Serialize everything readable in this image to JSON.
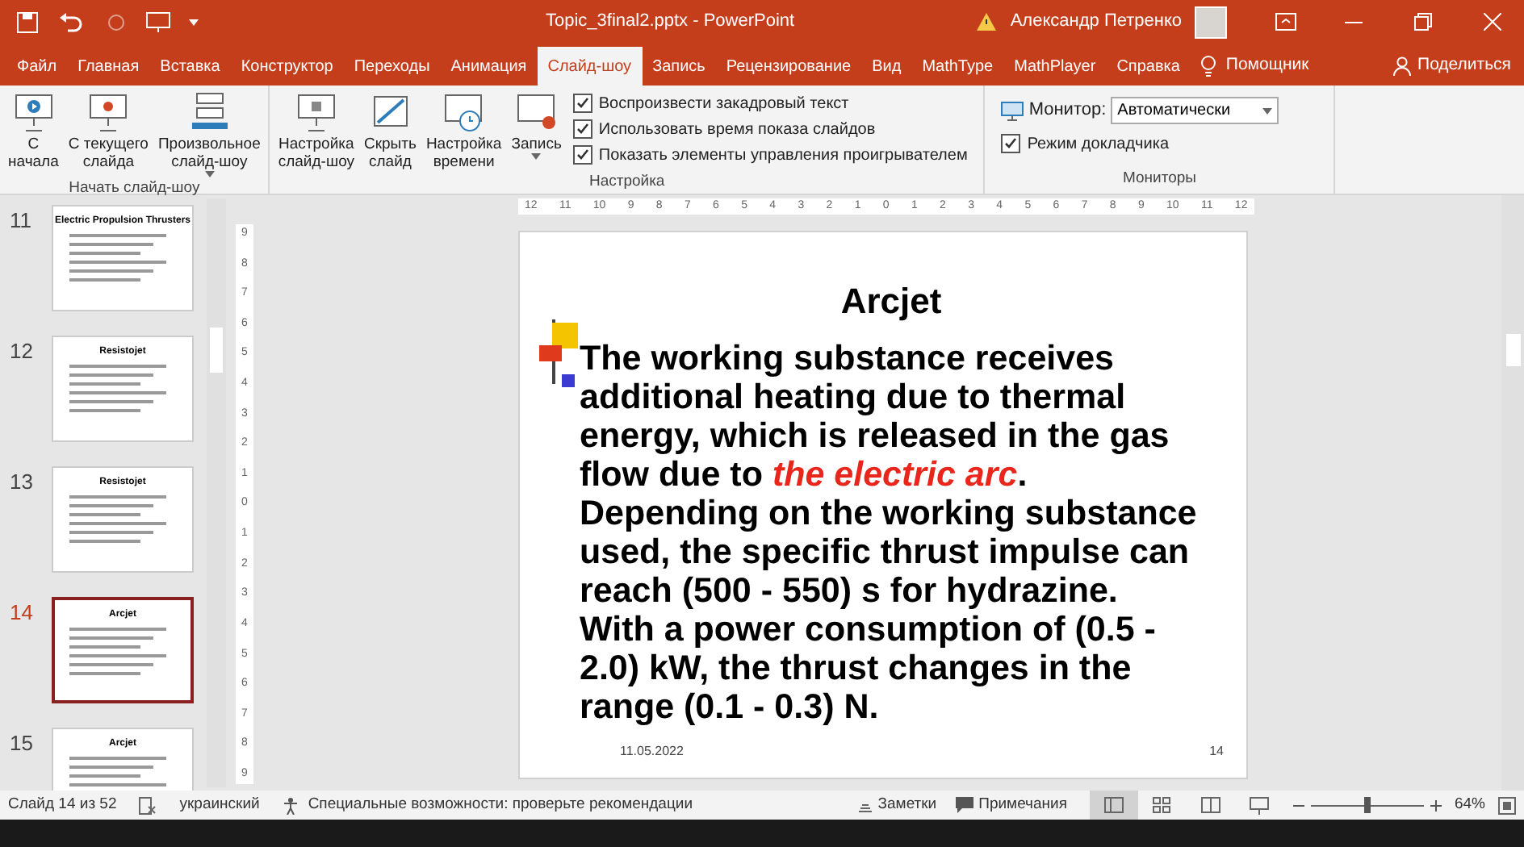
{
  "window": {
    "title": "Topic_3final2.pptx - PowerPoint",
    "user": "Александр Петренко"
  },
  "tabs": [
    {
      "label": "Файл",
      "selected": false
    },
    {
      "label": "Главная",
      "selected": false
    },
    {
      "label": "Вставка",
      "selected": false
    },
    {
      "label": "Конструктор",
      "selected": false
    },
    {
      "label": "Переходы",
      "selected": false
    },
    {
      "label": "Анимация",
      "selected": false
    },
    {
      "label": "Слайд-шоу",
      "selected": true
    },
    {
      "label": "Запись",
      "selected": false
    },
    {
      "label": "Рецензирование",
      "selected": false
    },
    {
      "label": "Вид",
      "selected": false
    },
    {
      "label": "MathType",
      "selected": false
    },
    {
      "label": "MathPlayer",
      "selected": false
    },
    {
      "label": "Справка",
      "selected": false
    }
  ],
  "assistant": "Помощник",
  "share": "Поделиться",
  "ribbon": {
    "groups": [
      {
        "title": "Начать слайд-шоу",
        "buttons": [
          {
            "label": "С\nначала",
            "caret": false
          },
          {
            "label": "С текущего\nслайда",
            "caret": false
          },
          {
            "label": "Произвольное\nслайд-шоу",
            "caret": true
          }
        ]
      },
      {
        "title": "Настройка",
        "buttons": [
          {
            "label": "Настройка\nслайд-шоу",
            "caret": false
          },
          {
            "label": "Скрыть\nслайд",
            "caret": false
          },
          {
            "label": "Настройка\nвремени",
            "caret": false
          },
          {
            "label": "Запись",
            "caret": true
          }
        ],
        "checkboxes": [
          {
            "label": "Воспроизвести закадровый текст",
            "checked": true
          },
          {
            "label": "Использовать время показа слайдов",
            "checked": true
          },
          {
            "label": "Показать элементы управления проигрывателем",
            "checked": true
          }
        ]
      },
      {
        "title": "Мониторы",
        "monitor_label": "Монитор:",
        "monitor_value": "Автоматически",
        "checkboxes": [
          {
            "label": "Режим докладчика",
            "checked": true
          }
        ]
      }
    ]
  },
  "thumbnails": [
    {
      "number": "11",
      "title": "Electric Propulsion Thrusters",
      "selected": false
    },
    {
      "number": "12",
      "title": "Resistojet",
      "selected": false
    },
    {
      "number": "13",
      "title": "Resistojet",
      "selected": false
    },
    {
      "number": "14",
      "title": "Arcjet",
      "selected": true
    },
    {
      "number": "15",
      "title": "Arcjet",
      "selected": false
    }
  ],
  "ruler_horizontal": [
    "12",
    "11",
    "10",
    "9",
    "8",
    "7",
    "6",
    "5",
    "4",
    "3",
    "2",
    "1",
    "0",
    "1",
    "2",
    "3",
    "4",
    "5",
    "6",
    "7",
    "8",
    "9",
    "10",
    "11",
    "12"
  ],
  "ruler_vertical": [
    "9",
    "8",
    "7",
    "6",
    "5",
    "4",
    "3",
    "2",
    "1",
    "0",
    "1",
    "2",
    "3",
    "4",
    "5",
    "6",
    "7",
    "8",
    "9"
  ],
  "slide": {
    "title": "Arcjet",
    "paragraphs": [
      [
        {
          "text": "The working substance receives additional heating due to thermal energy, which is released in the gas flow due to ",
          "emphasis": false
        },
        {
          "text": "the electric arc",
          "emphasis": true
        },
        {
          "text": ".",
          "emphasis": false
        }
      ],
      [
        {
          "text": "Depending on the working substance used, the specific thrust impulse can reach (500 - 550) s for hydrazine.",
          "emphasis": false
        }
      ],
      [
        {
          "text": "With a power consumption of (0.5 - 2.0) kW, the thrust changes in the range (0.1 - 0.3) N.",
          "emphasis": false
        }
      ]
    ],
    "date": "11.05.2022",
    "number": "14"
  },
  "status_bar": {
    "slide": "Слайд 14 из 52",
    "language": "украинский",
    "accessibility": "Специальные возможности: проверьте рекомендации",
    "notes": "Заметки",
    "comments": "Примечания",
    "views": [
      {
        "kind": "normal",
        "selected": true
      },
      {
        "kind": "sorter",
        "selected": false
      },
      {
        "kind": "reading",
        "selected": false
      },
      {
        "kind": "show",
        "selected": false
      }
    ],
    "zoom": {
      "level": 0.5,
      "reading": "64%"
    }
  }
}
